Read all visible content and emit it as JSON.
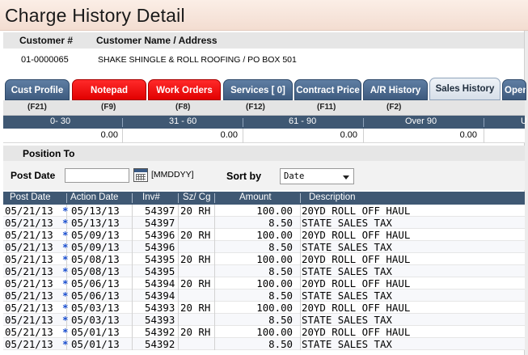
{
  "title": "Charge History Detail",
  "customer": {
    "number_label": "Customer #",
    "name_label": "Customer Name / Address",
    "number": "01-0000065",
    "name_address": "SHAKE SHINGLE & ROLL ROOFING  /  PO BOX 501"
  },
  "tabs": [
    {
      "label": "Cust Profile",
      "fkey": "(F21)",
      "style": "blue"
    },
    {
      "label": "Notepad",
      "fkey": "(F9)",
      "style": "red"
    },
    {
      "label": "Work Orders",
      "fkey": "(F8)",
      "style": "red"
    },
    {
      "label": "Services [    0]",
      "fkey": "(F12)",
      "style": "blue"
    },
    {
      "label": "Contract Price",
      "fkey": "(F11)",
      "style": "blue"
    },
    {
      "label": "A/R History",
      "fkey": "(F2)",
      "style": "blue"
    },
    {
      "label": "Sales History",
      "fkey": "",
      "style": "active"
    },
    {
      "label": "Open",
      "fkey": "",
      "style": "blue"
    }
  ],
  "aging": {
    "buckets": [
      "0- 30",
      "31 - 60",
      "61 - 90",
      "Over 90",
      "U"
    ],
    "values": [
      "0.00",
      "0.00",
      "0.00",
      "0.00"
    ]
  },
  "position_to": {
    "title": "Position To",
    "post_date_label": "Post Date",
    "post_date_value": "",
    "date_format_hint": "[MMDDYY]",
    "sort_by_label": "Sort by",
    "sort_by_value": "Date"
  },
  "grid": {
    "columns": [
      "Post Date",
      "Action Date",
      "Inv#",
      "Sz/ Cg",
      "Amount",
      "Description"
    ],
    "rows": [
      {
        "post": "05/21/13",
        "mark": "*",
        "action": "05/13/13",
        "inv": "54397",
        "size": "20 RH",
        "amount": "100.00",
        "desc": "20YD ROLL OFF HAUL"
      },
      {
        "post": "05/21/13",
        "mark": "*",
        "action": "05/13/13",
        "inv": "54397",
        "size": "",
        "amount": "8.50",
        "desc": "STATE SALES TAX"
      },
      {
        "post": "05/21/13",
        "mark": "*",
        "action": "05/09/13",
        "inv": "54396",
        "size": "20 RH",
        "amount": "100.00",
        "desc": "20YD ROLL OFF HAUL"
      },
      {
        "post": "05/21/13",
        "mark": "*",
        "action": "05/09/13",
        "inv": "54396",
        "size": "",
        "amount": "8.50",
        "desc": "STATE SALES TAX"
      },
      {
        "post": "05/21/13",
        "mark": "*",
        "action": "05/08/13",
        "inv": "54395",
        "size": "20 RH",
        "amount": "100.00",
        "desc": "20YD ROLL OFF HAUL"
      },
      {
        "post": "05/21/13",
        "mark": "*",
        "action": "05/08/13",
        "inv": "54395",
        "size": "",
        "amount": "8.50",
        "desc": "STATE SALES TAX"
      },
      {
        "post": "05/21/13",
        "mark": "*",
        "action": "05/06/13",
        "inv": "54394",
        "size": "20 RH",
        "amount": "100.00",
        "desc": "20YD ROLL OFF HAUL"
      },
      {
        "post": "05/21/13",
        "mark": "*",
        "action": "05/06/13",
        "inv": "54394",
        "size": "",
        "amount": "8.50",
        "desc": "STATE SALES TAX"
      },
      {
        "post": "05/21/13",
        "mark": "*",
        "action": "05/03/13",
        "inv": "54393",
        "size": "20 RH",
        "amount": "100.00",
        "desc": "20YD ROLL OFF HAUL"
      },
      {
        "post": "05/21/13",
        "mark": "*",
        "action": "05/03/13",
        "inv": "54393",
        "size": "",
        "amount": "8.50",
        "desc": "STATE SALES TAX"
      },
      {
        "post": "05/21/13",
        "mark": "*",
        "action": "05/01/13",
        "inv": "54392",
        "size": "20 RH",
        "amount": "100.00",
        "desc": "20YD ROLL OFF HAUL"
      },
      {
        "post": "05/21/13",
        "mark": "*",
        "action": "05/01/13",
        "inv": "54392",
        "size": "",
        "amount": "8.50",
        "desc": "STATE SALES TAX"
      }
    ]
  }
}
